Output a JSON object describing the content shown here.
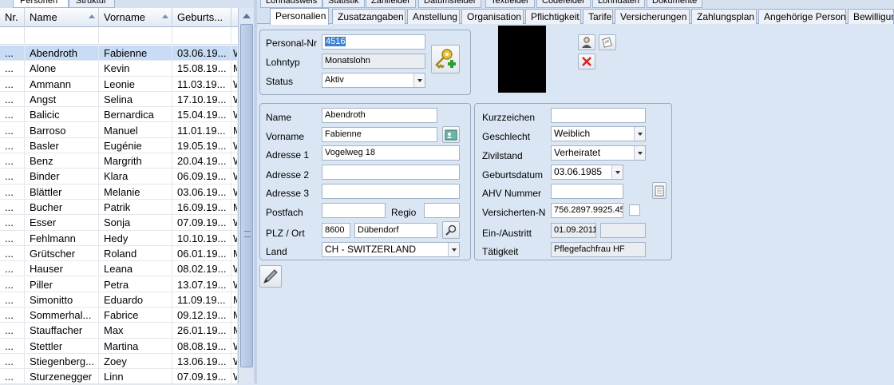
{
  "left_tabs": [
    "Personen",
    "Struktur"
  ],
  "grid": {
    "headers": [
      "Nr.",
      "Name",
      "Vorname",
      "Geburts..."
    ],
    "rows": [
      {
        "nr": "...",
        "name": "Abendroth",
        "vorname": "Fabienne",
        "geb": "03.06.19...",
        "x": "W"
      },
      {
        "nr": "...",
        "name": "Alone",
        "vorname": "Kevin",
        "geb": "15.08.19...",
        "x": "M"
      },
      {
        "nr": "...",
        "name": "Ammann",
        "vorname": "Leonie",
        "geb": "11.03.19...",
        "x": "W"
      },
      {
        "nr": "...",
        "name": "Angst",
        "vorname": "Selina",
        "geb": "17.10.19...",
        "x": "W"
      },
      {
        "nr": "...",
        "name": "Balicic",
        "vorname": "Bernardica",
        "geb": "15.04.19...",
        "x": "W"
      },
      {
        "nr": "...",
        "name": "Barroso",
        "vorname": "Manuel",
        "geb": "11.01.19...",
        "x": "M"
      },
      {
        "nr": "...",
        "name": "Basler",
        "vorname": "Eugénie",
        "geb": "19.05.19...",
        "x": "W"
      },
      {
        "nr": "...",
        "name": "Benz",
        "vorname": "Margrith",
        "geb": "20.04.19...",
        "x": "W"
      },
      {
        "nr": "...",
        "name": "Binder",
        "vorname": "Klara",
        "geb": "06.09.19...",
        "x": "W"
      },
      {
        "nr": "...",
        "name": "Blättler",
        "vorname": "Melanie",
        "geb": "03.06.19...",
        "x": "W"
      },
      {
        "nr": "...",
        "name": "Bucher",
        "vorname": "Patrik",
        "geb": "16.09.19...",
        "x": "M"
      },
      {
        "nr": "...",
        "name": "Esser",
        "vorname": "Sonja",
        "geb": "07.09.19...",
        "x": "W"
      },
      {
        "nr": "...",
        "name": "Fehlmann",
        "vorname": "Hedy",
        "geb": "10.10.19...",
        "x": "W"
      },
      {
        "nr": "...",
        "name": "Grütscher",
        "vorname": "Roland",
        "geb": "06.01.19...",
        "x": "M"
      },
      {
        "nr": "...",
        "name": "Hauser",
        "vorname": "Leana",
        "geb": "08.02.19...",
        "x": "W"
      },
      {
        "nr": "...",
        "name": "Piller",
        "vorname": "Petra",
        "geb": "13.07.19...",
        "x": "W"
      },
      {
        "nr": "...",
        "name": "Simonitto",
        "vorname": "Eduardo",
        "geb": "11.09.19...",
        "x": "M"
      },
      {
        "nr": "...",
        "name": "Sommerhal...",
        "vorname": "Fabrice",
        "geb": "09.12.19...",
        "x": "M"
      },
      {
        "nr": "...",
        "name": "Stauffacher",
        "vorname": "Max",
        "geb": "26.01.19...",
        "x": "M"
      },
      {
        "nr": "...",
        "name": "Stettler",
        "vorname": "Martina",
        "geb": "08.08.19...",
        "x": "W"
      },
      {
        "nr": "...",
        "name": "Stiegenberg...",
        "vorname": "Zoey",
        "geb": "13.06.19...",
        "x": "W"
      },
      {
        "nr": "...",
        "name": "Sturzenegger",
        "vorname": "Linn",
        "geb": "07.09.19...",
        "x": "W"
      }
    ]
  },
  "top_tabs": [
    "Lohnausweis",
    "Statistik",
    "Zahlfelder",
    "Datumsfelder",
    "Textfelder",
    "Codefelder",
    "Lohndaten",
    "Dokumente"
  ],
  "sub_tabs": [
    "Personalien",
    "Zusatzangaben",
    "Anstellung",
    "Organisation",
    "Pflichtigkeit",
    "Tarife",
    "Versicherungen",
    "Zahlungsplan",
    "Angehörige Person",
    "Bewilligung"
  ],
  "form": {
    "personal_nr_label": "Personal-Nr",
    "personal_nr": "4516",
    "lohntyp_label": "Lohntyp",
    "lohntyp": "Monatslohn",
    "status_label": "Status",
    "status": "Aktiv",
    "name_label": "Name",
    "name": "Abendroth",
    "vorname_label": "Vorname",
    "vorname": "Fabienne",
    "adresse1_label": "Adresse 1",
    "adresse1": "Vogelweg 18",
    "adresse2_label": "Adresse 2",
    "adresse2": "",
    "adresse3_label": "Adresse 3",
    "adresse3": "",
    "postfach_label": "Postfach",
    "postfach": "",
    "regio_label": "Regio",
    "regio": "",
    "plz_label": "PLZ / Ort",
    "plz": "8600",
    "ort": "Dübendorf",
    "land_label": "Land",
    "land": "CH - SWITZERLAND",
    "kurzzeichen_label": "Kurzzeichen",
    "kurzzeichen": "",
    "geschlecht_label": "Geschlecht",
    "geschlecht": "Weiblich",
    "zivilstand_label": "Zivilstand",
    "zivilstand": "Verheiratet",
    "geburtsdatum_label": "Geburtsdatum",
    "geburtsdatum": "03.06.1985",
    "ahv_label": "AHV Nummer",
    "ahv": "",
    "versicherten_label": "Versicherten-N",
    "versicherten": "756.2897.9925.45",
    "eintritt_label": "Ein-/Austritt",
    "eintritt": "01.09.2011",
    "austritt": "",
    "taetigkeit_label": "Tätigkeit",
    "taetigkeit": "Pflegefachfrau HF"
  }
}
